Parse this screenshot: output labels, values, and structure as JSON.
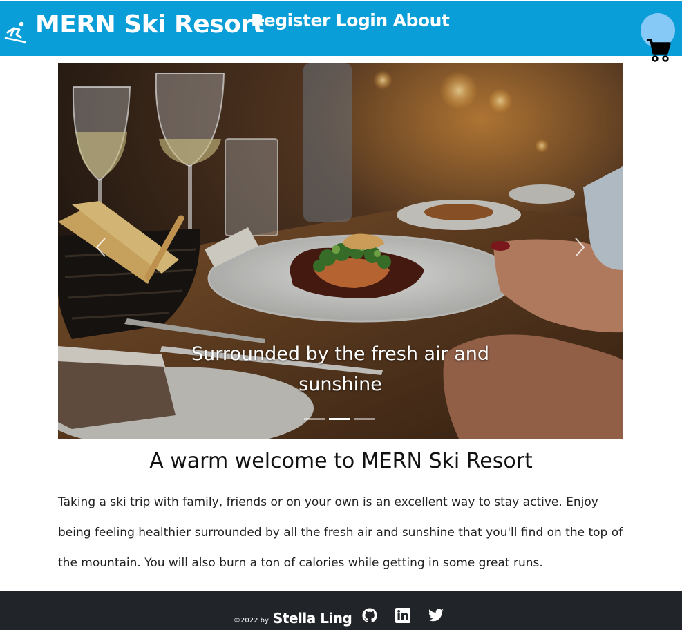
{
  "header": {
    "brand_title": "MERN Ski Resort",
    "brand_icon": "skier-icon",
    "nav": [
      "Register",
      "Login",
      "About"
    ],
    "cart_icon": "shopping-cart-icon",
    "colors": {
      "bar": "#0a9ed8",
      "cart_circle": "#86c9f7"
    }
  },
  "carousel": {
    "caption": "Surrounded by the fresh air and sunshine",
    "slide_count": 3,
    "active_slide": 2,
    "image": "restaurant-dinner-table-photo"
  },
  "main": {
    "welcome_title": "A warm welcome to MERN Ski Resort",
    "intro": "Taking a ski trip with family, friends or on your own is an excellent way to stay active. Enjoy being feeling healthier surrounded by all the fresh air and sunshine that you'll find on the top of the mountain. You will also burn a ton of calories while getting in some great runs."
  },
  "footer": {
    "copyright": "©2022 by",
    "author": "Stella Ling",
    "social": [
      "github-icon",
      "linkedin-icon",
      "twitter-icon"
    ],
    "color": "#212529"
  }
}
